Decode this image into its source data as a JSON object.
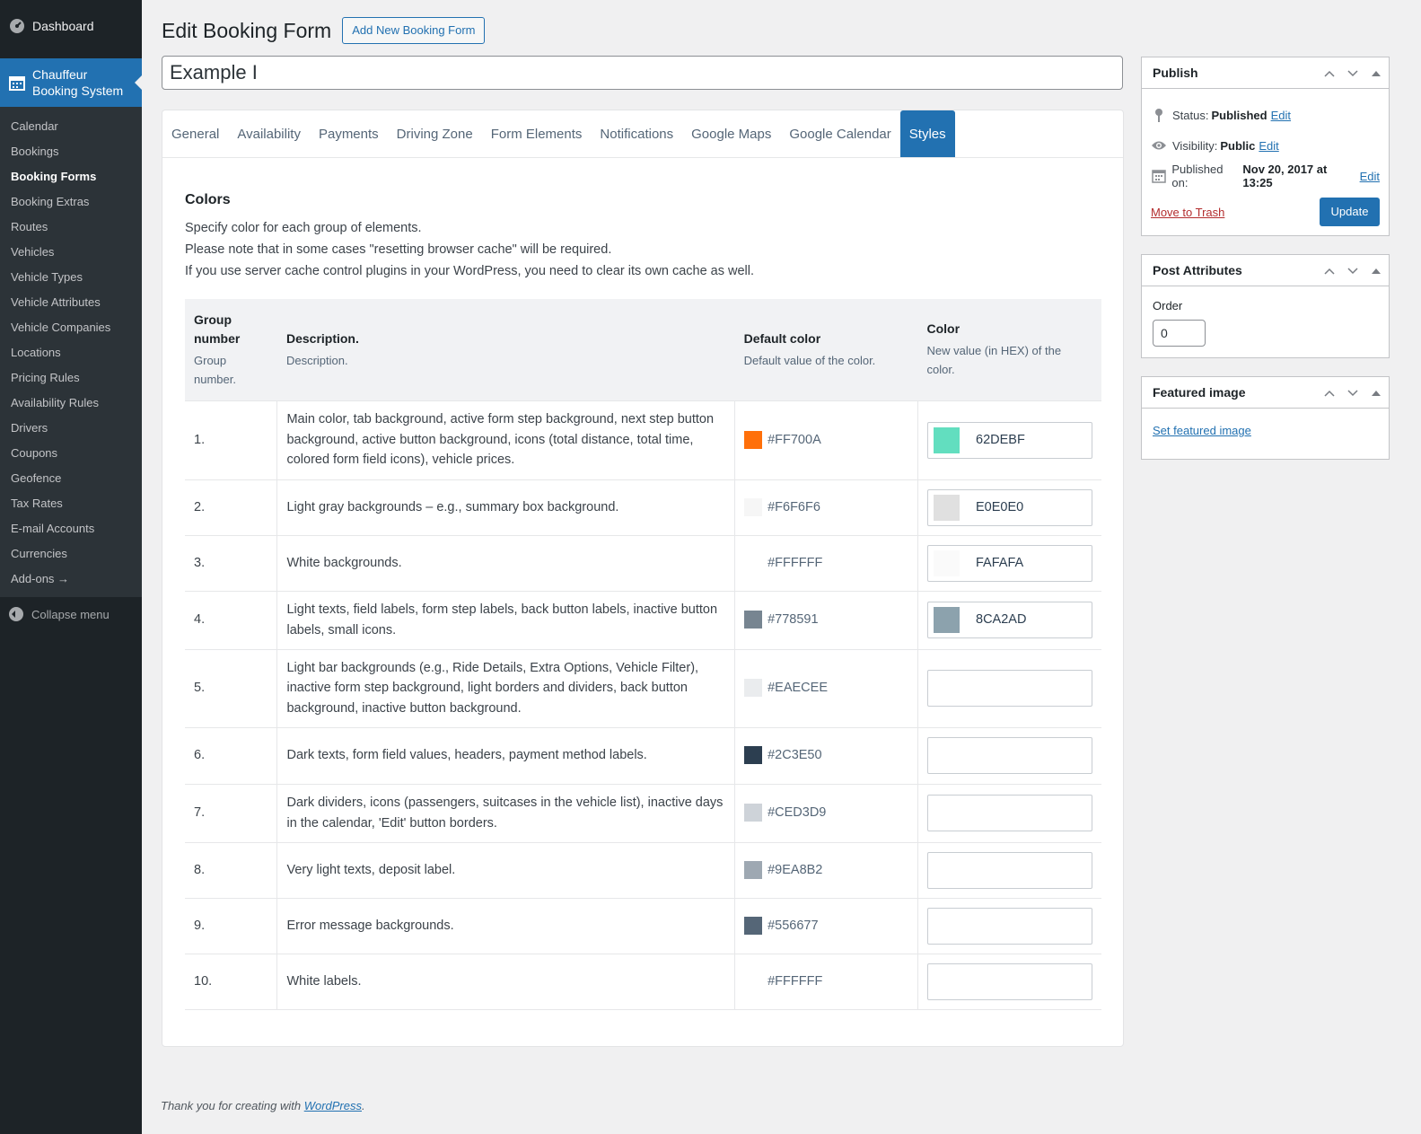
{
  "sidebar": {
    "dashboard": "Dashboard",
    "active_menu": "Chauffeur Booking System",
    "sub_items": [
      {
        "label": "Calendar"
      },
      {
        "label": "Bookings"
      },
      {
        "label": "Booking Forms",
        "current": true
      },
      {
        "label": "Booking Extras"
      },
      {
        "label": "Routes"
      },
      {
        "label": "Vehicles"
      },
      {
        "label": "Vehicle Types"
      },
      {
        "label": "Vehicle Attributes"
      },
      {
        "label": "Vehicle Companies"
      },
      {
        "label": "Locations"
      },
      {
        "label": "Pricing Rules"
      },
      {
        "label": "Availability Rules"
      },
      {
        "label": "Drivers"
      },
      {
        "label": "Coupons"
      },
      {
        "label": "Geofence"
      },
      {
        "label": "Tax Rates"
      },
      {
        "label": "E-mail Accounts"
      },
      {
        "label": "Currencies"
      },
      {
        "label": "Add-ons →"
      }
    ],
    "collapse": "Collapse menu"
  },
  "header": {
    "title": "Edit Booking Form",
    "add_new": "Add New Booking Form",
    "post_title": "Example I"
  },
  "tabs": [
    {
      "label": "General"
    },
    {
      "label": "Availability"
    },
    {
      "label": "Payments"
    },
    {
      "label": "Driving Zone"
    },
    {
      "label": "Form Elements"
    },
    {
      "label": "Notifications"
    },
    {
      "label": "Google Maps"
    },
    {
      "label": "Google Calendar"
    },
    {
      "label": "Styles",
      "active": true
    }
  ],
  "colors_section": {
    "title": "Colors",
    "intro": [
      "Specify color for each group of elements.",
      "Please note that in some cases \"resetting browser cache\" will be required.",
      "If you use server cache control plugins in your WordPress, you need to clear its own cache as well."
    ],
    "headers": {
      "group": {
        "main": "Group number",
        "sub": "Group number."
      },
      "desc": {
        "main": "Description.",
        "sub": "Description."
      },
      "default": {
        "main": "Default color",
        "sub": "Default value of the color."
      },
      "color": {
        "main": "Color",
        "sub": "New value (in HEX) of the color."
      }
    },
    "rows": [
      {
        "num": "1.",
        "desc": "Main color, tab background, active form step background, next step button background, active button background, icons (total distance, total time, colored form field icons), vehicle prices.",
        "default": "#FF700A",
        "value": "62DEBF"
      },
      {
        "num": "2.",
        "desc": "Light gray backgrounds – e.g., summary box background.",
        "default": "#F6F6F6",
        "value": "E0E0E0"
      },
      {
        "num": "3.",
        "desc": "White backgrounds.",
        "default": "#FFFFFF",
        "value": "FAFAFA"
      },
      {
        "num": "4.",
        "desc": "Light texts, field labels, form step labels, back button labels, inactive button labels, small icons.",
        "default": "#778591",
        "value": "8CA2AD"
      },
      {
        "num": "5.",
        "desc": "Light bar backgrounds (e.g., Ride Details, Extra Options, Vehicle Filter), inactive form step background, light borders and dividers, back button background, inactive button background.",
        "default": "#EAECEE",
        "value": ""
      },
      {
        "num": "6.",
        "desc": "Dark texts, form field values, headers, payment method labels.",
        "default": "#2C3E50",
        "value": ""
      },
      {
        "num": "7.",
        "desc": "Dark dividers, icons (passengers, suitcases in the vehicle list), inactive days in the calendar, 'Edit' button borders.",
        "default": "#CED3D9",
        "value": ""
      },
      {
        "num": "8.",
        "desc": "Very light texts, deposit label.",
        "default": "#9EA8B2",
        "value": ""
      },
      {
        "num": "9.",
        "desc": "Error message backgrounds.",
        "default": "#556677",
        "value": ""
      },
      {
        "num": "10.",
        "desc": "White labels.",
        "default": "#FFFFFF",
        "value": ""
      }
    ]
  },
  "publish": {
    "title": "Publish",
    "status_label": "Status:",
    "status_value": "Published",
    "visibility_label": "Visibility:",
    "visibility_value": "Public",
    "published_label": "Published on:",
    "published_value": "Nov 20, 2017 at 13:25",
    "edit": "Edit",
    "trash": "Move to Trash",
    "update": "Update"
  },
  "attributes": {
    "title": "Post Attributes",
    "order_label": "Order",
    "order_value": "0"
  },
  "featured": {
    "title": "Featured image",
    "link": "Set featured image"
  },
  "footer": {
    "text": "Thank you for creating with",
    "link": "WordPress"
  }
}
